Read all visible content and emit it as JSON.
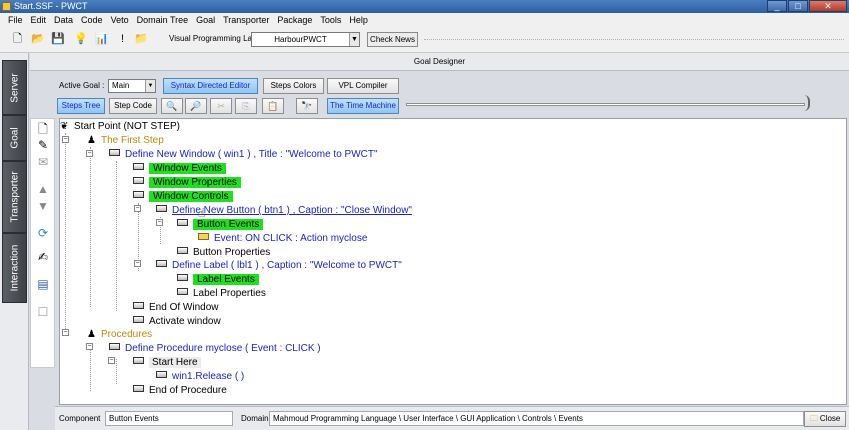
{
  "window": {
    "title": "Start.SSF  - PWCT",
    "minimize": "_",
    "maximize": "□",
    "close": "✕"
  },
  "menu": [
    "File",
    "Edit",
    "Data",
    "Code",
    "Veto",
    "Domain Tree",
    "Goal",
    "Transporter",
    "Package",
    "Tools",
    "Help"
  ],
  "toolbar": {
    "language_label": "Visual Programming Language",
    "language_value": "HarbourPWCT",
    "check_news": "Check News"
  },
  "sidetabs": [
    "Server",
    "Goal",
    "Transporter",
    "Interaction"
  ],
  "designer": {
    "title": "Goal Designer",
    "active_goal_label": "Active Goal :",
    "active_goal_value": "Main",
    "buttons": {
      "syntax_editor": "Syntax Directed Editor",
      "steps_colors": "Steps Colors",
      "vpl_compiler": "VPL Compiler",
      "steps_tree": "Steps Tree",
      "step_code": "Step Code",
      "time_machine": "The Time Machine"
    }
  },
  "tree": [
    "Start Point (NOT STEP)",
    "The First Step",
    "Define New Window  ( win1 ) , Title : \"Welcome to PWCT\"",
    "Window Events",
    "Window Properties",
    "Window Controls",
    "Define New Button ( btn1 ) , Caption : \"Close Window\"",
    "Button Events",
    "Event: ON CLICK : Action myclose",
    "Button Properties",
    "Define Label ( lbl1 ) , Caption : \"Welcome to PWCT\"",
    "Label Events",
    "Label Properties",
    "End Of Window",
    "Activate window",
    "Procedures",
    "Define Procedure myclose ( Event : CLICK )",
    "Start Here",
    "win1.Release ( )",
    "End of Procedure"
  ],
  "status": {
    "component_label": "Component",
    "component_value": "Button Events",
    "domain_label": "Domain",
    "domain_value": "Mahmoud Programming Language \\ User Interface \\ GUI Application \\ Controls \\ Events",
    "close": "Close"
  }
}
